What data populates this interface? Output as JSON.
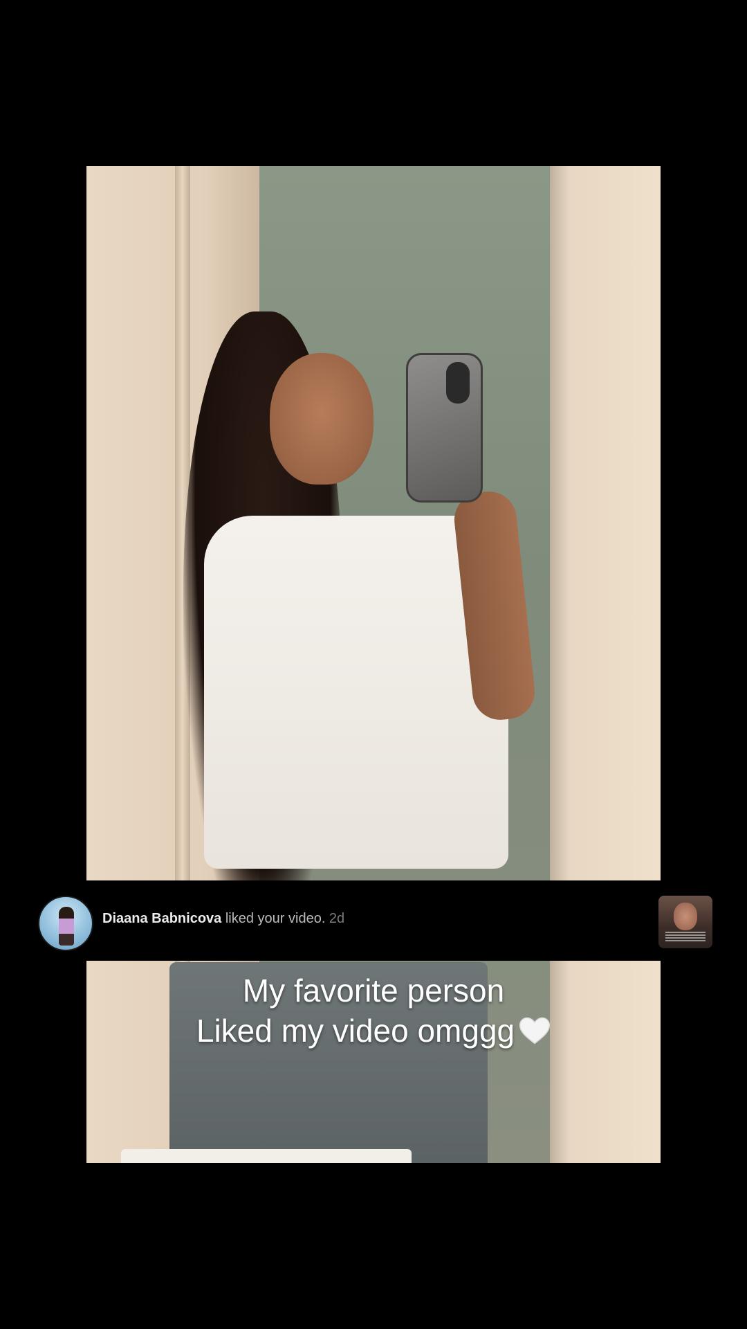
{
  "notification": {
    "username": "Diaana Babnicova",
    "action": " liked your video.",
    "time": " 2d",
    "avatar_icon": "profile-avatar",
    "thumbnail_icon": "video-thumbnail"
  },
  "caption": {
    "line1": "My favorite person",
    "line2": "Liked my video omggg",
    "emoji_icon": "white-heart-icon"
  },
  "colors": {
    "background": "#000000",
    "notif_name": "#ececec",
    "notif_text": "#bcbcbc",
    "notif_time": "#7c7c7c",
    "caption_text": "#ffffff"
  }
}
